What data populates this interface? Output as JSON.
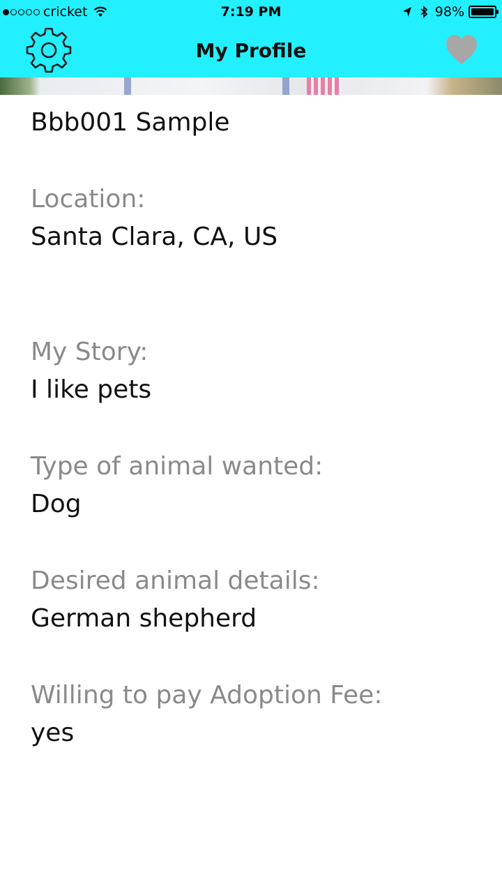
{
  "status_bar": {
    "carrier": "cricket",
    "time": "7:19 PM",
    "battery": "98%"
  },
  "nav": {
    "title": "My Profile"
  },
  "profile": {
    "name": "Bbb001 Sample",
    "location_label": "Location:",
    "location_value": "Santa Clara, CA, US",
    "story_label": "My Story:",
    "story_value": "I like pets",
    "animal_type_label": "Type of animal wanted:",
    "animal_type_value": "Dog",
    "details_label": "Desired animal details:",
    "details_value": "German shepherd",
    "fee_label": "Willing to pay Adoption Fee:",
    "fee_value": "yes"
  },
  "colors": {
    "header_bg": "#22f0fe",
    "label": "#8a8a8a",
    "value": "#111111",
    "heart": "#a7a7a7"
  }
}
